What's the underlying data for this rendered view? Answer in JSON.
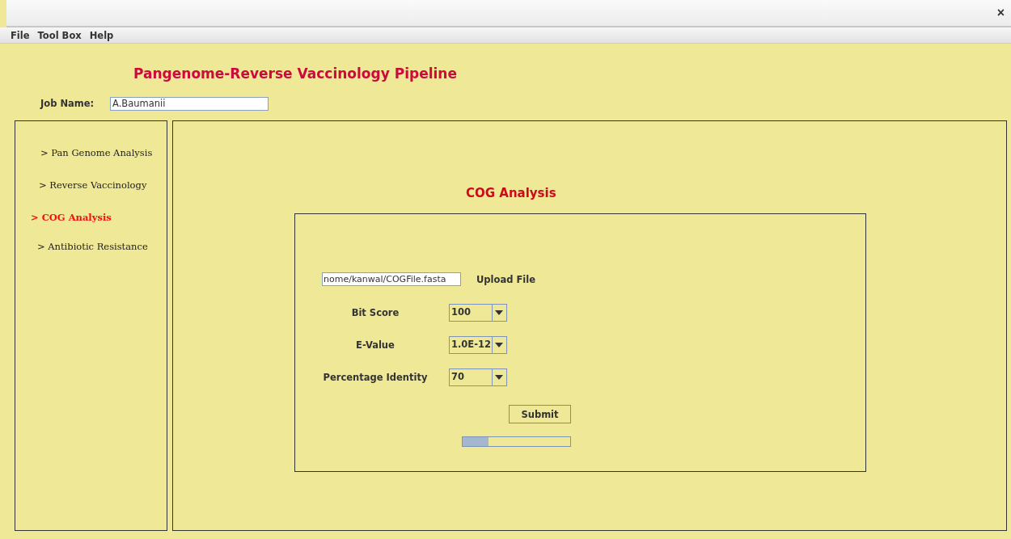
{
  "window": {
    "close": "×"
  },
  "menu": [
    "File",
    "Tool Box",
    "Help"
  ],
  "title": "Pangenome-Reverse Vaccinology Pipeline",
  "job": {
    "label": "Job Name:",
    "value": "A.Baumanii"
  },
  "sidebar": {
    "items": [
      {
        "label": "> Pan Genome Analysis",
        "selected": false
      },
      {
        "label": "> Reverse Vaccinology",
        "selected": false
      },
      {
        "label": "> COG Analysis",
        "selected": true
      },
      {
        "label": "> Antibiotic Resistance",
        "selected": false
      }
    ]
  },
  "panel": {
    "heading": "COG Analysis",
    "file_path": "nome/kanwal/COGFile.fasta",
    "upload": "Upload File",
    "options": [
      {
        "label": "Bit Score",
        "value": "100"
      },
      {
        "label": "E-Value",
        "value": "1.0E-12"
      },
      {
        "label": "Percentage Identity",
        "value": "70"
      }
    ],
    "submit": "Submit",
    "progress": {
      "level": 0.24
    }
  }
}
